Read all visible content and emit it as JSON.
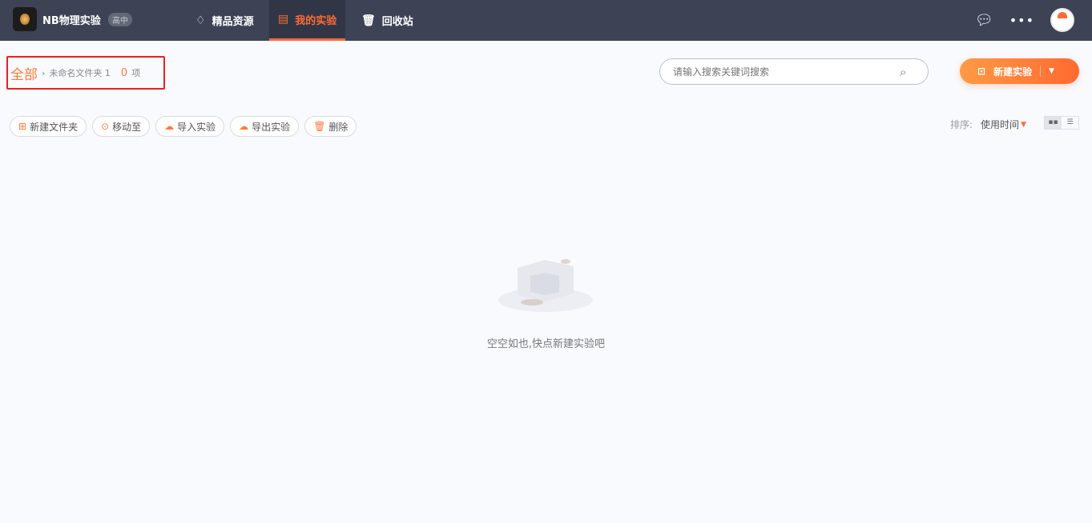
{
  "header": {
    "app_name": "NB物理实验",
    "level_badge": "高中",
    "nav": [
      {
        "label": "精品资源",
        "icon": "diamond-icon"
      },
      {
        "label": "我的实验",
        "icon": "folder-icon",
        "active": true
      },
      {
        "label": "回收站",
        "icon": "trash-icon"
      }
    ]
  },
  "breadcrumb": {
    "root": "全部",
    "separator": "›",
    "folder": "未命名文件夹 1",
    "count": "0",
    "count_unit": "项"
  },
  "search": {
    "placeholder": "请输入搜索关键词搜索"
  },
  "new_button": {
    "label": "新建实验"
  },
  "toolbar": [
    {
      "label": "新建文件夹",
      "icon": "⊞"
    },
    {
      "label": "移动至",
      "icon": "⊙"
    },
    {
      "label": "导入实验",
      "icon": "☁"
    },
    {
      "label": "导出实验",
      "icon": "☁"
    },
    {
      "label": "删除",
      "icon": "🗑"
    }
  ],
  "sort": {
    "label": "排序:",
    "value": "使用时间"
  },
  "empty": {
    "message": "空空如也,快点新建实验吧"
  },
  "colors": {
    "accent": "#ff6b34",
    "header_bg": "#3d4354"
  }
}
